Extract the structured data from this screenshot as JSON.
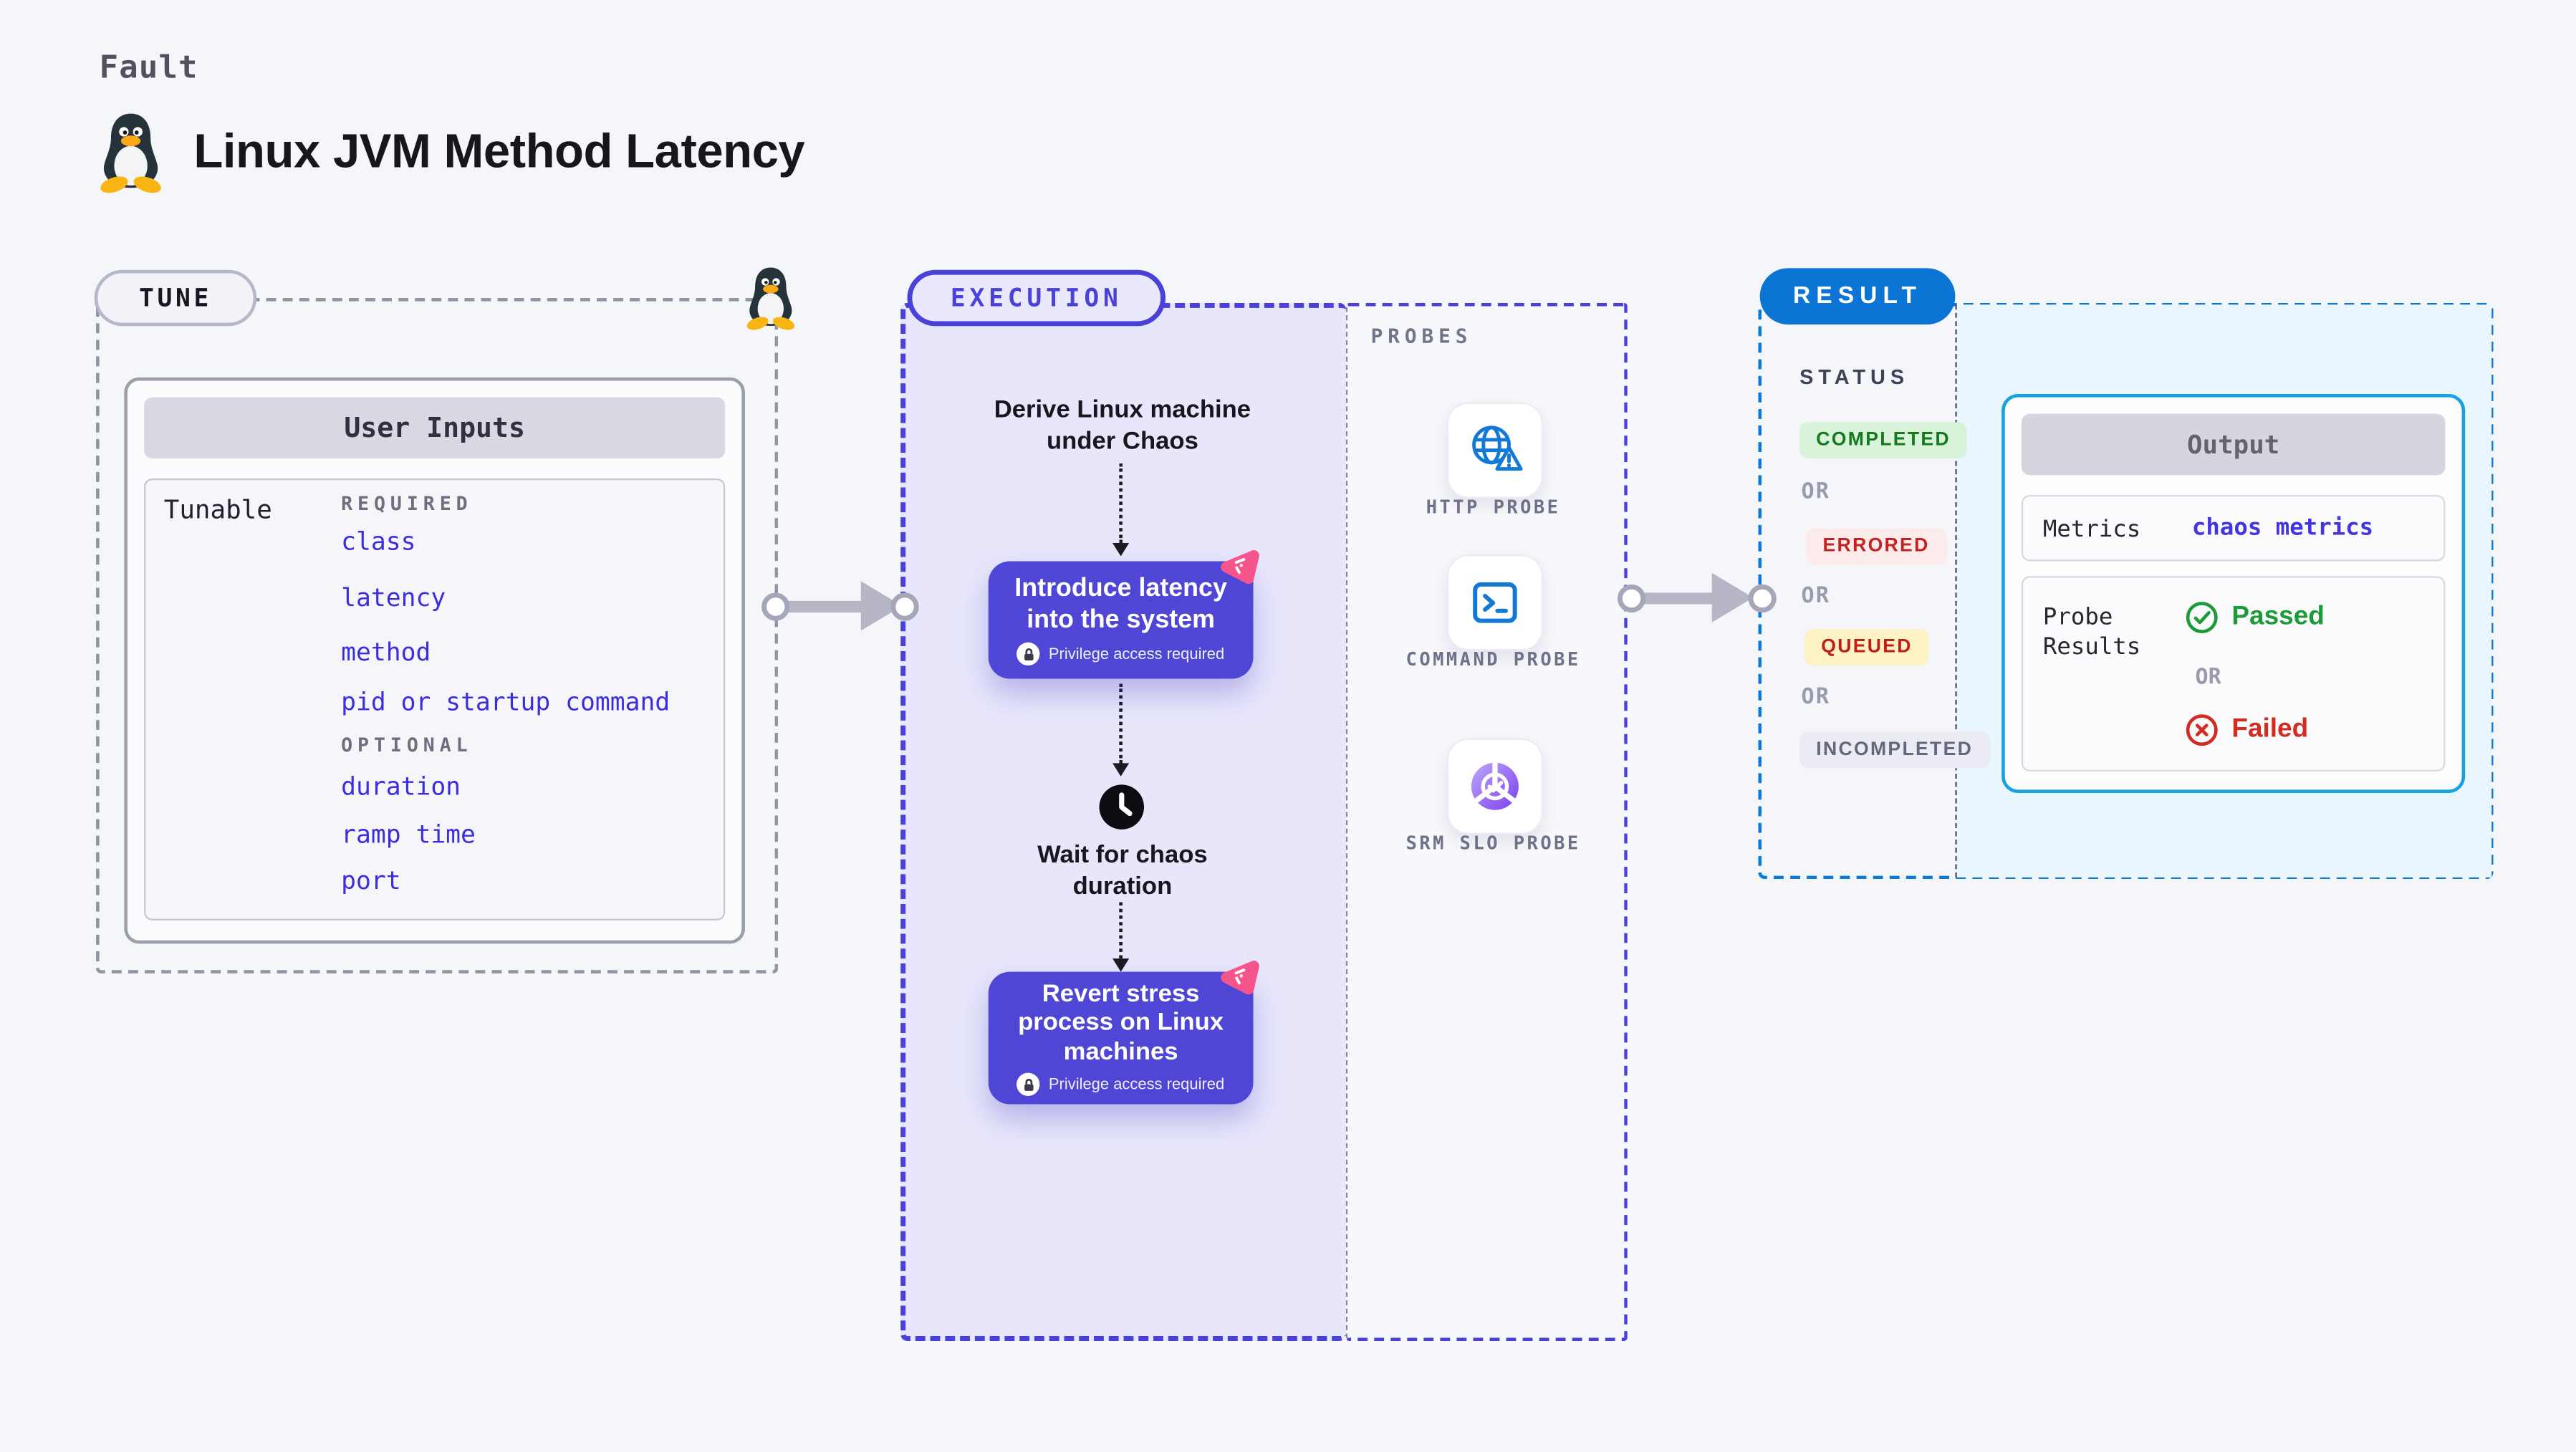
{
  "header": {
    "eyebrow": "Fault",
    "title": "Linux JVM Method Latency"
  },
  "tune": {
    "badge": "TUNE",
    "table_title": "User Inputs",
    "row_label": "Tunable",
    "required_label": "REQUIRED",
    "required_fields": [
      "class",
      "latency",
      "method",
      "pid or startup command"
    ],
    "optional_label": "OPTIONAL",
    "optional_fields": [
      "duration",
      "ramp time",
      "port"
    ]
  },
  "execution": {
    "badge": "EXECUTION",
    "steps": {
      "derive": "Derive Linux machine under Chaos",
      "introduce": "Introduce latency into the system",
      "wait": "Wait for chaos duration",
      "revert": "Revert stress process on Linux machines"
    },
    "privilege_note": "Privilege access required"
  },
  "probes": {
    "label": "PROBES",
    "items": [
      {
        "name": "HTTP PROBE",
        "icon": "globe-alert-icon"
      },
      {
        "name": "COMMAND PROBE",
        "icon": "terminal-icon"
      },
      {
        "name": "SRM SLO PROBE",
        "icon": "slo-donut-icon"
      }
    ]
  },
  "result": {
    "badge": "RESULT",
    "status_label": "STATUS",
    "or_label": "OR",
    "statuses": {
      "completed": "COMPLETED",
      "errored": "ERRORED",
      "queued": "QUEUED",
      "incompleted": "INCOMPLETED"
    },
    "output": {
      "title": "Output",
      "metrics_label": "Metrics",
      "metrics_value": "chaos metrics",
      "probe_results_label": "Probe Results",
      "passed_label": "Passed",
      "failed_label": "Failed"
    }
  },
  "colors": {
    "accent_indigo": "#4f46d6",
    "accent_blue": "#0c74d4",
    "accent_cyan": "#16a3e0",
    "accent_pink": "#f5548c",
    "link_indigo": "#3b2ee0",
    "status_green": "#157a1e",
    "status_red": "#c32322",
    "panel_lavender": "#e7e6fb",
    "result_fill": "#e9f6fd"
  }
}
